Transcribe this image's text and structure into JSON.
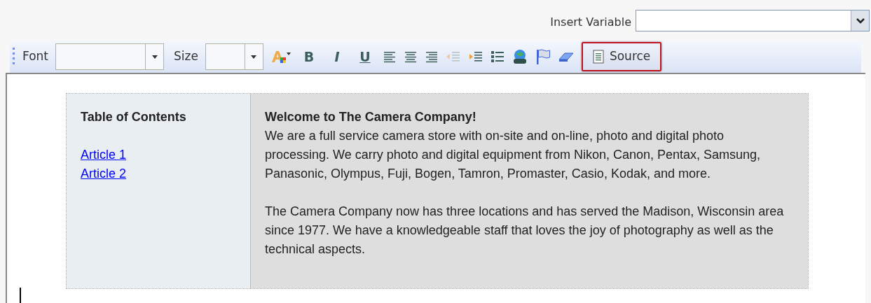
{
  "insert_variable": {
    "label": "Insert Variable"
  },
  "toolbar": {
    "font_label": "Font",
    "size_label": "Size",
    "format_buttons": [
      "B",
      "I",
      "U"
    ],
    "source": {
      "label": "Source",
      "highlighted": true
    }
  },
  "content": {
    "toc": {
      "title": "Table of Contents",
      "links": [
        "Article 1",
        "Article 2"
      ]
    },
    "main": {
      "title": "Welcome to The Camera Company!",
      "paragraphs": [
        "We are a full service camera store with on-site and on-line, photo and digital photo processing. We carry photo and digital equipment from Nikon, Canon, Pentax, Samsung, Panasonic, Olympus, Fuji, Bogen, Tamron, Promaster, Casio, Kodak, and more.",
        "The Camera Company now has three locations and has served the Madison, Wisconsin area since 1977. We have a knowledgeable staff that loves the joy of photography as well as the technical aspects."
      ]
    }
  }
}
